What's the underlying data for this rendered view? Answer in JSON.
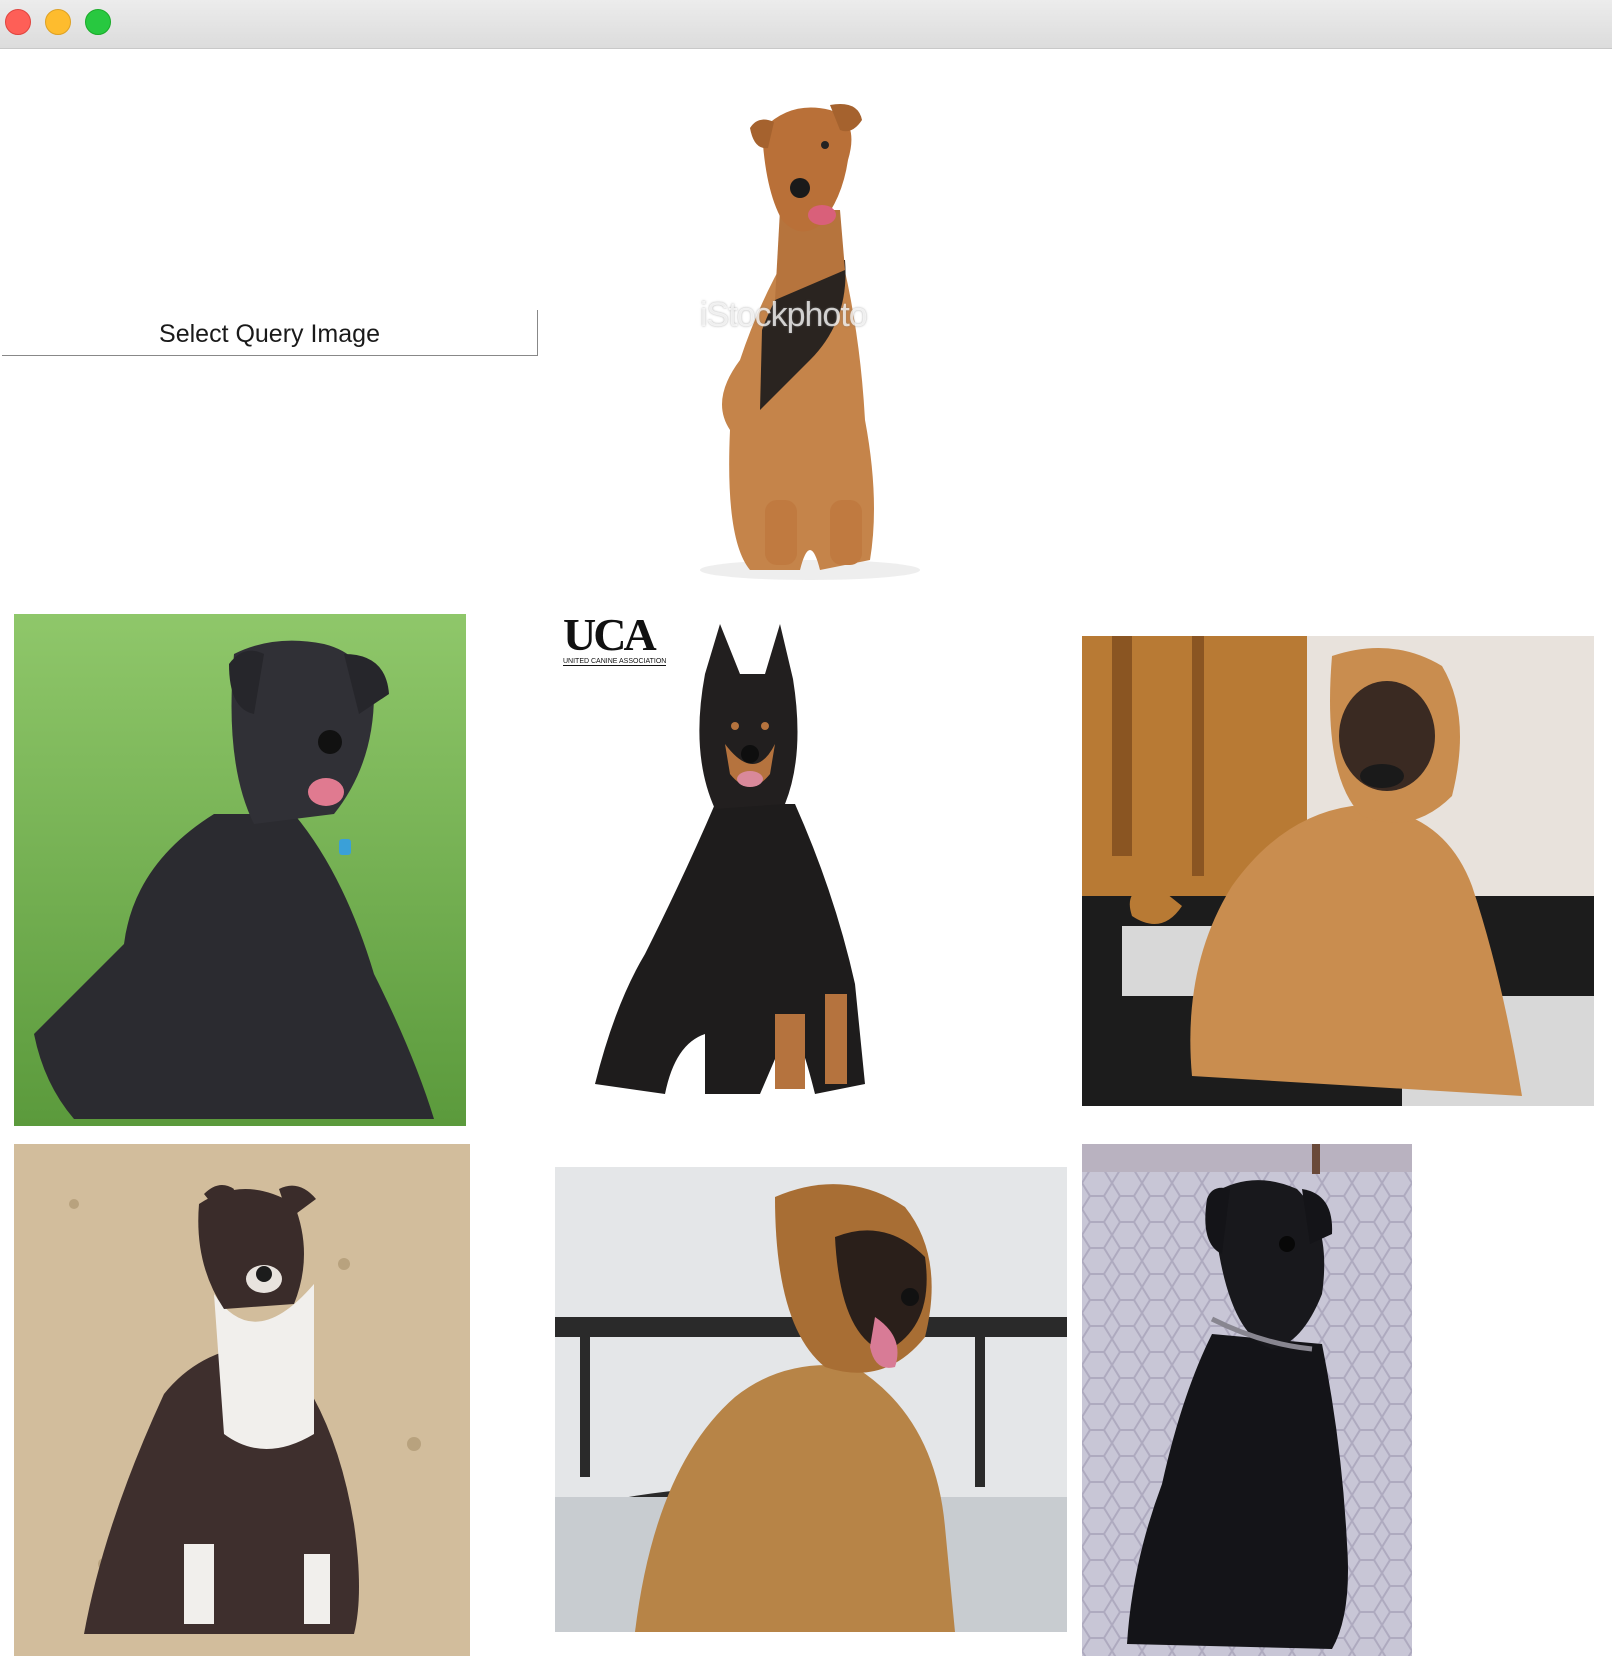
{
  "window": {
    "controls": [
      "close",
      "minimize",
      "zoom"
    ]
  },
  "query": {
    "button_label": "Select Query Image",
    "image": {
      "subject": "airedale-terrier-icon",
      "watermark": "iStockphoto"
    }
  },
  "results": [
    {
      "subject": "black-curly-dog-on-grass-icon"
    },
    {
      "subject": "black-tan-shepherd-icon",
      "logo": "UCA",
      "logo_caption": "UNITED CANINE ASSOCIATION"
    },
    {
      "subject": "shar-pei-icon"
    },
    {
      "subject": "pit-bull-terrier-icon"
    },
    {
      "subject": "leonberger-icon"
    },
    {
      "subject": "black-terrier-icon"
    }
  ]
}
